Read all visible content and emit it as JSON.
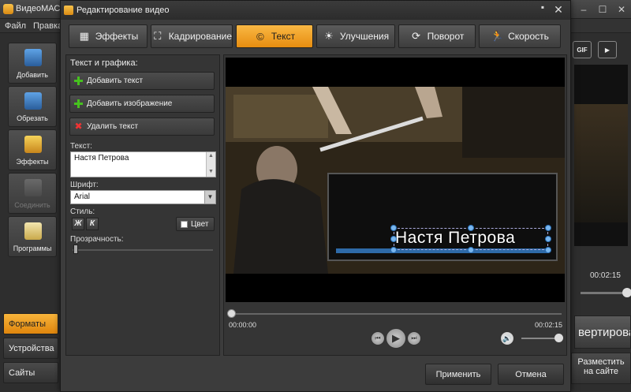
{
  "app": {
    "title": "ВидеоМАСТ",
    "menu": [
      "Файл",
      "Правка"
    ],
    "toolbar": [
      {
        "label": "Добавить",
        "icon": "film-add-icon"
      },
      {
        "label": "Обрезать",
        "icon": "film-cut-icon"
      },
      {
        "label": "Эффекты",
        "icon": "magic-wand-icon"
      },
      {
        "label": "Соединить",
        "icon": "join-icon"
      },
      {
        "label": "Программы",
        "icon": "pencil-tools-icon"
      }
    ],
    "bottom_tabs": [
      "Форматы",
      "Устройства",
      "Сайты"
    ],
    "right_panel": {
      "gif_label": "GIF",
      "time": "00:02:15",
      "convert_label": "вертировать",
      "place_label_1": "Разместить",
      "place_label_2": "на сайте"
    }
  },
  "dialog": {
    "title": "Редактирование видео",
    "tabs": [
      {
        "label": "Эффекты",
        "icon": "film-effects-icon"
      },
      {
        "label": "Кадрирование",
        "icon": "crop-icon"
      },
      {
        "label": "Текст",
        "icon": "copyright-icon"
      },
      {
        "label": "Улучшения",
        "icon": "sun-icon"
      },
      {
        "label": "Поворот",
        "icon": "rotate-icon"
      },
      {
        "label": "Скорость",
        "icon": "running-man-icon"
      }
    ],
    "active_tab": "Текст",
    "left_pane": {
      "heading": "Текст и графика:",
      "add_text": "Добавить текст",
      "add_image": "Добавить изображение",
      "delete_text": "Удалить текст",
      "text_label": "Текст:",
      "text_value": "Настя Петрова",
      "font_label": "Шрифт:",
      "font_value": "Arial",
      "style_label": "Стиль:",
      "bold_label": "Ж",
      "italic_label": "К",
      "color_label": "Цвет",
      "opacity_label": "Прозрачность:"
    },
    "preview": {
      "overlay_text": "Настя Петрова",
      "time_start": "00:00:00",
      "time_end": "00:02:15"
    },
    "footer": {
      "apply": "Применить",
      "cancel": "Отмена"
    }
  }
}
